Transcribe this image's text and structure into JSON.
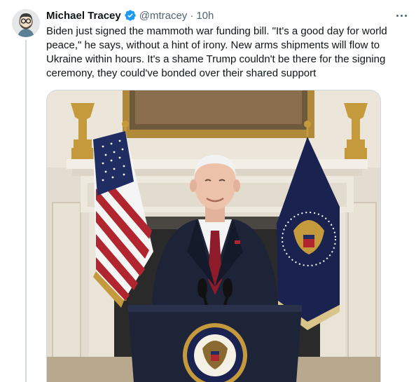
{
  "tweet": {
    "author_name": "Michael Tracey",
    "handle": "@mtracey",
    "separator": "·",
    "time": "10h",
    "text": "Biden just signed the mammoth war funding bill. \"It's a good day for world peace,\" he says, without a hint of irony. New arms shipments will flow to Ukraine within hours. It's a shame Trump couldn't be there for the signing ceremony, they could've bonded over their shared support"
  },
  "icons": {
    "verified": "verified-badge-icon",
    "more": "more-options-icon"
  },
  "colors": {
    "verified_blue": "#1d9bf0",
    "secondary_text": "#536471",
    "primary_text": "#0f1419",
    "divider": "#cfd9de"
  },
  "media": {
    "seal_text": "PRESIDENT OF THE UNITED STATES"
  }
}
